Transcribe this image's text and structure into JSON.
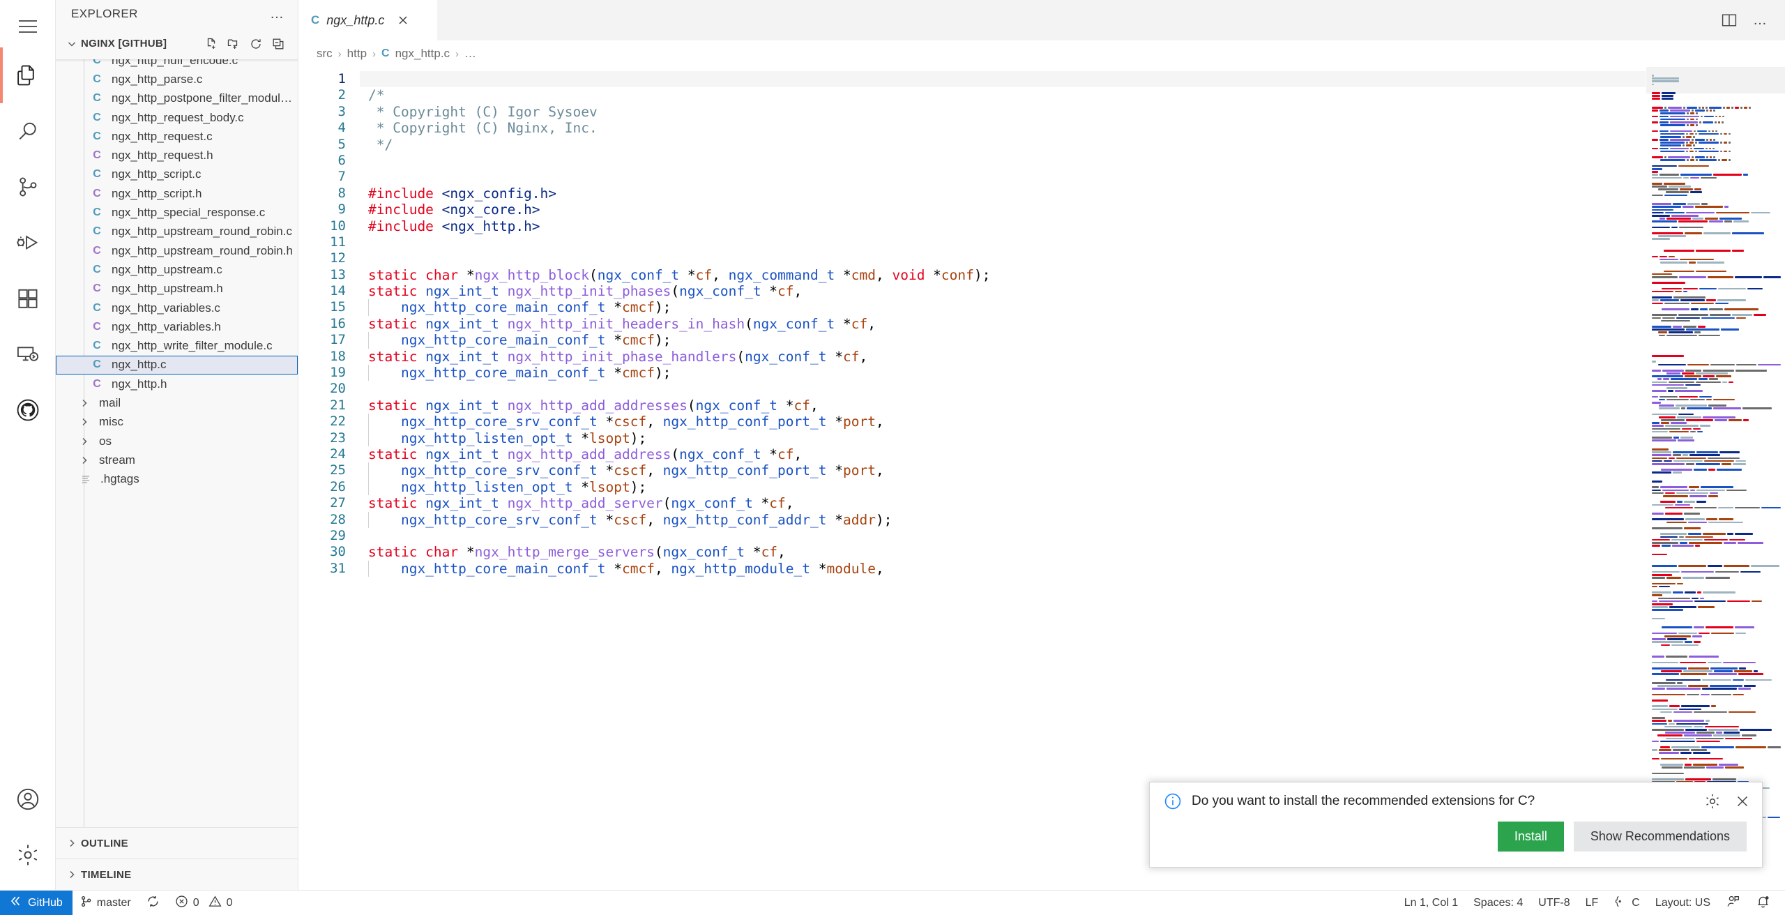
{
  "activity_bar": {
    "items": [
      {
        "name": "menu-icon",
        "tooltip": "Menu"
      },
      {
        "name": "explorer-icon",
        "tooltip": "Explorer",
        "active": true
      },
      {
        "name": "search-icon",
        "tooltip": "Search"
      },
      {
        "name": "source-control-icon",
        "tooltip": "Source Control"
      },
      {
        "name": "run-debug-icon",
        "tooltip": "Run and Debug"
      },
      {
        "name": "extensions-icon",
        "tooltip": "Extensions"
      },
      {
        "name": "remote-explorer-icon",
        "tooltip": "Remote Explorer"
      },
      {
        "name": "github-icon",
        "tooltip": "GitHub"
      }
    ],
    "bottom_items": [
      {
        "name": "accounts-icon",
        "tooltip": "Accounts"
      },
      {
        "name": "settings-gear-icon",
        "tooltip": "Manage"
      }
    ]
  },
  "sidebar": {
    "title": "EXPLORER",
    "more_actions": "…",
    "project": {
      "label": "NGINX [GITHUB]",
      "expanded": true,
      "actions": [
        "new-file-icon",
        "new-folder-icon",
        "refresh-icon",
        "collapse-all-icon"
      ]
    },
    "tree": [
      {
        "label": "ngx_http_huff_encode.c",
        "type": "file",
        "icon": "c-source",
        "partial_top": true
      },
      {
        "label": "ngx_http_parse.c",
        "type": "file",
        "icon": "c-source"
      },
      {
        "label": "ngx_http_postpone_filter_module.c",
        "type": "file",
        "icon": "c-source"
      },
      {
        "label": "ngx_http_request_body.c",
        "type": "file",
        "icon": "c-source"
      },
      {
        "label": "ngx_http_request.c",
        "type": "file",
        "icon": "c-source"
      },
      {
        "label": "ngx_http_request.h",
        "type": "file",
        "icon": "c-header"
      },
      {
        "label": "ngx_http_script.c",
        "type": "file",
        "icon": "c-source"
      },
      {
        "label": "ngx_http_script.h",
        "type": "file",
        "icon": "c-header"
      },
      {
        "label": "ngx_http_special_response.c",
        "type": "file",
        "icon": "c-source"
      },
      {
        "label": "ngx_http_upstream_round_robin.c",
        "type": "file",
        "icon": "c-source"
      },
      {
        "label": "ngx_http_upstream_round_robin.h",
        "type": "file",
        "icon": "c-header"
      },
      {
        "label": "ngx_http_upstream.c",
        "type": "file",
        "icon": "c-source"
      },
      {
        "label": "ngx_http_upstream.h",
        "type": "file",
        "icon": "c-header"
      },
      {
        "label": "ngx_http_variables.c",
        "type": "file",
        "icon": "c-source"
      },
      {
        "label": "ngx_http_variables.h",
        "type": "file",
        "icon": "c-header"
      },
      {
        "label": "ngx_http_write_filter_module.c",
        "type": "file",
        "icon": "c-source"
      },
      {
        "label": "ngx_http.c",
        "type": "file",
        "icon": "c-source",
        "selected": true
      },
      {
        "label": "ngx_http.h",
        "type": "file",
        "icon": "c-header"
      },
      {
        "label": "mail",
        "type": "folder",
        "expanded": false
      },
      {
        "label": "misc",
        "type": "folder",
        "expanded": false
      },
      {
        "label": "os",
        "type": "folder",
        "expanded": false
      },
      {
        "label": "stream",
        "type": "folder",
        "expanded": false
      },
      {
        "label": ".hgtags",
        "type": "file",
        "icon": "text-file"
      }
    ],
    "outline": {
      "label": "OUTLINE",
      "expanded": false
    },
    "timeline": {
      "label": "TIMELINE",
      "expanded": false
    }
  },
  "editor": {
    "tab": {
      "label": "ngx_http.c",
      "icon": "c-source",
      "preview": true,
      "close": "close-icon"
    },
    "tab_actions": [
      "split-editor-icon",
      "more-actions-icon"
    ],
    "breadcrumb": [
      "src",
      "http",
      "ngx_http.c",
      "…"
    ],
    "first_line": 1,
    "cursor_line": 1,
    "lines": [
      {
        "n": 1,
        "tokens": []
      },
      {
        "n": 2,
        "tokens": [
          {
            "t": "com",
            "s": "/*"
          }
        ]
      },
      {
        "n": 3,
        "tokens": [
          {
            "t": "com",
            "s": " * Copyright (C) Igor Sysoev"
          }
        ]
      },
      {
        "n": 4,
        "tokens": [
          {
            "t": "com",
            "s": " * Copyright (C) Nginx, Inc."
          }
        ]
      },
      {
        "n": 5,
        "tokens": [
          {
            "t": "com",
            "s": " */"
          }
        ]
      },
      {
        "n": 6,
        "tokens": []
      },
      {
        "n": 7,
        "tokens": []
      },
      {
        "n": 8,
        "tokens": [
          {
            "t": "pre",
            "s": "#include "
          },
          {
            "t": "inc",
            "s": "<ngx_config.h>"
          }
        ]
      },
      {
        "n": 9,
        "tokens": [
          {
            "t": "pre",
            "s": "#include "
          },
          {
            "t": "inc",
            "s": "<ngx_core.h>"
          }
        ]
      },
      {
        "n": 10,
        "tokens": [
          {
            "t": "pre",
            "s": "#include "
          },
          {
            "t": "inc",
            "s": "<ngx_http.h>"
          }
        ]
      },
      {
        "n": 11,
        "tokens": []
      },
      {
        "n": 12,
        "tokens": []
      },
      {
        "n": 13,
        "tokens": [
          {
            "t": "kw",
            "s": "static char "
          },
          {
            "t": "punc",
            "s": "*"
          },
          {
            "t": "fn",
            "s": "ngx_http_block"
          },
          {
            "t": "punc",
            "s": "("
          },
          {
            "t": "typ",
            "s": "ngx_conf_t "
          },
          {
            "t": "punc",
            "s": "*"
          },
          {
            "t": "var",
            "s": "cf"
          },
          {
            "t": "punc",
            "s": ", "
          },
          {
            "t": "typ",
            "s": "ngx_command_t "
          },
          {
            "t": "punc",
            "s": "*"
          },
          {
            "t": "var",
            "s": "cmd"
          },
          {
            "t": "punc",
            "s": ", "
          },
          {
            "t": "kw",
            "s": "void "
          },
          {
            "t": "punc",
            "s": "*"
          },
          {
            "t": "var",
            "s": "conf"
          },
          {
            "t": "punc",
            "s": ");"
          }
        ]
      },
      {
        "n": 14,
        "tokens": [
          {
            "t": "kw",
            "s": "static "
          },
          {
            "t": "typ",
            "s": "ngx_int_t "
          },
          {
            "t": "fn",
            "s": "ngx_http_init_phases"
          },
          {
            "t": "punc",
            "s": "("
          },
          {
            "t": "typ",
            "s": "ngx_conf_t "
          },
          {
            "t": "punc",
            "s": "*"
          },
          {
            "t": "var",
            "s": "cf"
          },
          {
            "t": "punc",
            "s": ","
          }
        ]
      },
      {
        "n": 15,
        "indent": 1,
        "tokens": [
          {
            "t": "typ",
            "s": "ngx_http_core_main_conf_t "
          },
          {
            "t": "punc",
            "s": "*"
          },
          {
            "t": "var",
            "s": "cmcf"
          },
          {
            "t": "punc",
            "s": ");"
          }
        ]
      },
      {
        "n": 16,
        "tokens": [
          {
            "t": "kw",
            "s": "static "
          },
          {
            "t": "typ",
            "s": "ngx_int_t "
          },
          {
            "t": "fn",
            "s": "ngx_http_init_headers_in_hash"
          },
          {
            "t": "punc",
            "s": "("
          },
          {
            "t": "typ",
            "s": "ngx_conf_t "
          },
          {
            "t": "punc",
            "s": "*"
          },
          {
            "t": "var",
            "s": "cf"
          },
          {
            "t": "punc",
            "s": ","
          }
        ]
      },
      {
        "n": 17,
        "indent": 1,
        "tokens": [
          {
            "t": "typ",
            "s": "ngx_http_core_main_conf_t "
          },
          {
            "t": "punc",
            "s": "*"
          },
          {
            "t": "var",
            "s": "cmcf"
          },
          {
            "t": "punc",
            "s": ");"
          }
        ]
      },
      {
        "n": 18,
        "tokens": [
          {
            "t": "kw",
            "s": "static "
          },
          {
            "t": "typ",
            "s": "ngx_int_t "
          },
          {
            "t": "fn",
            "s": "ngx_http_init_phase_handlers"
          },
          {
            "t": "punc",
            "s": "("
          },
          {
            "t": "typ",
            "s": "ngx_conf_t "
          },
          {
            "t": "punc",
            "s": "*"
          },
          {
            "t": "var",
            "s": "cf"
          },
          {
            "t": "punc",
            "s": ","
          }
        ]
      },
      {
        "n": 19,
        "indent": 1,
        "tokens": [
          {
            "t": "typ",
            "s": "ngx_http_core_main_conf_t "
          },
          {
            "t": "punc",
            "s": "*"
          },
          {
            "t": "var",
            "s": "cmcf"
          },
          {
            "t": "punc",
            "s": ");"
          }
        ]
      },
      {
        "n": 20,
        "tokens": []
      },
      {
        "n": 21,
        "tokens": [
          {
            "t": "kw",
            "s": "static "
          },
          {
            "t": "typ",
            "s": "ngx_int_t "
          },
          {
            "t": "fn",
            "s": "ngx_http_add_addresses"
          },
          {
            "t": "punc",
            "s": "("
          },
          {
            "t": "typ",
            "s": "ngx_conf_t "
          },
          {
            "t": "punc",
            "s": "*"
          },
          {
            "t": "var",
            "s": "cf"
          },
          {
            "t": "punc",
            "s": ","
          }
        ]
      },
      {
        "n": 22,
        "indent": 1,
        "tokens": [
          {
            "t": "typ",
            "s": "ngx_http_core_srv_conf_t "
          },
          {
            "t": "punc",
            "s": "*"
          },
          {
            "t": "var",
            "s": "cscf"
          },
          {
            "t": "punc",
            "s": ", "
          },
          {
            "t": "typ",
            "s": "ngx_http_conf_port_t "
          },
          {
            "t": "punc",
            "s": "*"
          },
          {
            "t": "var",
            "s": "port"
          },
          {
            "t": "punc",
            "s": ","
          }
        ]
      },
      {
        "n": 23,
        "indent": 1,
        "tokens": [
          {
            "t": "typ",
            "s": "ngx_http_listen_opt_t "
          },
          {
            "t": "punc",
            "s": "*"
          },
          {
            "t": "var",
            "s": "lsopt"
          },
          {
            "t": "punc",
            "s": ");"
          }
        ]
      },
      {
        "n": 24,
        "tokens": [
          {
            "t": "kw",
            "s": "static "
          },
          {
            "t": "typ",
            "s": "ngx_int_t "
          },
          {
            "t": "fn",
            "s": "ngx_http_add_address"
          },
          {
            "t": "punc",
            "s": "("
          },
          {
            "t": "typ",
            "s": "ngx_conf_t "
          },
          {
            "t": "punc",
            "s": "*"
          },
          {
            "t": "var",
            "s": "cf"
          },
          {
            "t": "punc",
            "s": ","
          }
        ]
      },
      {
        "n": 25,
        "indent": 1,
        "tokens": [
          {
            "t": "typ",
            "s": "ngx_http_core_srv_conf_t "
          },
          {
            "t": "punc",
            "s": "*"
          },
          {
            "t": "var",
            "s": "cscf"
          },
          {
            "t": "punc",
            "s": ", "
          },
          {
            "t": "typ",
            "s": "ngx_http_conf_port_t "
          },
          {
            "t": "punc",
            "s": "*"
          },
          {
            "t": "var",
            "s": "port"
          },
          {
            "t": "punc",
            "s": ","
          }
        ]
      },
      {
        "n": 26,
        "indent": 1,
        "tokens": [
          {
            "t": "typ",
            "s": "ngx_http_listen_opt_t "
          },
          {
            "t": "punc",
            "s": "*"
          },
          {
            "t": "var",
            "s": "lsopt"
          },
          {
            "t": "punc",
            "s": ");"
          }
        ]
      },
      {
        "n": 27,
        "tokens": [
          {
            "t": "kw",
            "s": "static "
          },
          {
            "t": "typ",
            "s": "ngx_int_t "
          },
          {
            "t": "fn",
            "s": "ngx_http_add_server"
          },
          {
            "t": "punc",
            "s": "("
          },
          {
            "t": "typ",
            "s": "ngx_conf_t "
          },
          {
            "t": "punc",
            "s": "*"
          },
          {
            "t": "var",
            "s": "cf"
          },
          {
            "t": "punc",
            "s": ","
          }
        ]
      },
      {
        "n": 28,
        "indent": 1,
        "tokens": [
          {
            "t": "typ",
            "s": "ngx_http_core_srv_conf_t "
          },
          {
            "t": "punc",
            "s": "*"
          },
          {
            "t": "var",
            "s": "cscf"
          },
          {
            "t": "punc",
            "s": ", "
          },
          {
            "t": "typ",
            "s": "ngx_http_conf_addr_t "
          },
          {
            "t": "punc",
            "s": "*"
          },
          {
            "t": "var",
            "s": "addr"
          },
          {
            "t": "punc",
            "s": ");"
          }
        ]
      },
      {
        "n": 29,
        "tokens": []
      },
      {
        "n": 30,
        "tokens": [
          {
            "t": "kw",
            "s": "static char "
          },
          {
            "t": "punc",
            "s": "*"
          },
          {
            "t": "fn",
            "s": "ngx_http_merge_servers"
          },
          {
            "t": "punc",
            "s": "("
          },
          {
            "t": "typ",
            "s": "ngx_conf_t "
          },
          {
            "t": "punc",
            "s": "*"
          },
          {
            "t": "var",
            "s": "cf"
          },
          {
            "t": "punc",
            "s": ","
          }
        ]
      },
      {
        "n": 31,
        "indent": 1,
        "tokens": [
          {
            "t": "typ",
            "s": "ngx_http_core_main_conf_t "
          },
          {
            "t": "punc",
            "s": "*"
          },
          {
            "t": "var",
            "s": "cmcf"
          },
          {
            "t": "punc",
            "s": ", "
          },
          {
            "t": "typ",
            "s": "ngx_http_module_t "
          },
          {
            "t": "punc",
            "s": "*"
          },
          {
            "t": "var",
            "s": "module"
          },
          {
            "t": "punc",
            "s": ","
          }
        ]
      }
    ]
  },
  "notification": {
    "icon": "info-icon",
    "message": "Do you want to install the recommended extensions for C?",
    "gear": "gear-icon",
    "close": "close-icon",
    "primary_button": "Install",
    "secondary_button": "Show Recommendations",
    "primary_color": "#2ca44e"
  },
  "statusbar": {
    "remote": {
      "label": "GitHub",
      "icon": "remote-icon",
      "color": "#1177d4"
    },
    "branch": {
      "label": "master",
      "icon": "source-control-icon"
    },
    "sync": {
      "icon": "sync-icon"
    },
    "problems": {
      "errors": "0",
      "warnings": "0",
      "error_icon": "error-circle-icon",
      "warning_icon": "warning-triangle-icon"
    },
    "right": [
      {
        "name": "cursor-position",
        "label": "Ln 1, Col 1"
      },
      {
        "name": "indentation",
        "label": "Spaces: 4"
      },
      {
        "name": "encoding",
        "label": "UTF-8"
      },
      {
        "name": "eol",
        "label": "LF"
      },
      {
        "name": "language-mode",
        "label": "C",
        "icon": "braces-icon"
      },
      {
        "name": "keyboard-layout",
        "label": "Layout: US"
      },
      {
        "name": "feedback",
        "label": "",
        "icon": "feedback-icon"
      },
      {
        "name": "notifications",
        "label": "",
        "icon": "bell-icon"
      }
    ]
  }
}
